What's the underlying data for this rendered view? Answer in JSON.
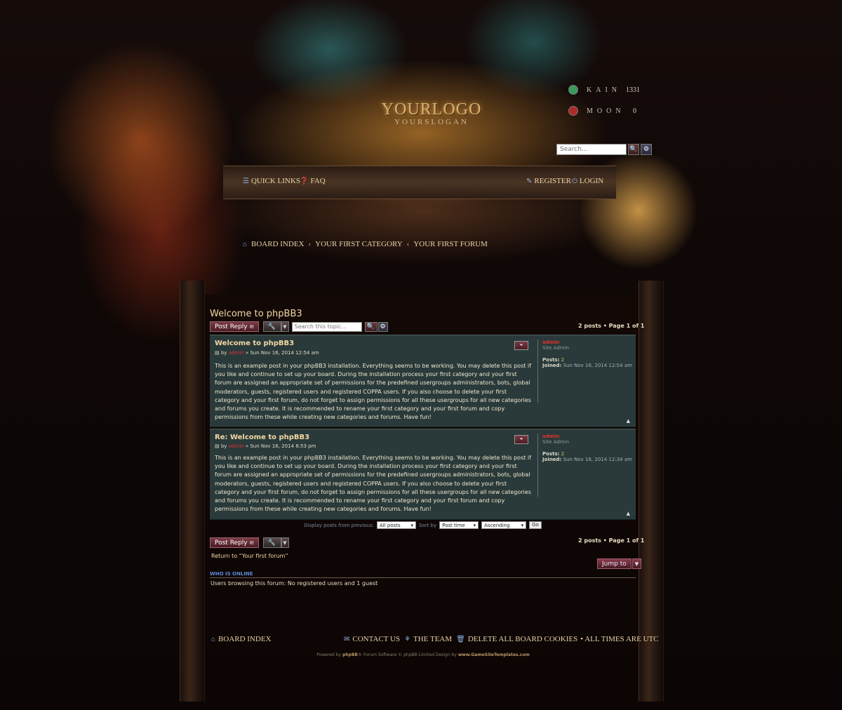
{
  "header": {
    "logo_text": "YOURLOGO",
    "slogan": "YOURSLOGAN",
    "servers": [
      {
        "name": "KAIN",
        "count": "1331",
        "status_color": "#3a9a5a"
      },
      {
        "name": "MOON",
        "count": "0",
        "status_color": "#b02a2a"
      }
    ],
    "search_placeholder": "Search...",
    "search_icon": "magnifier-icon",
    "advanced_icon": "gear-icon"
  },
  "nav": {
    "quick_links": "QUICK LINKS",
    "faq": "FAQ",
    "register": "REGISTER",
    "login": "LOGIN"
  },
  "breadcrumb": [
    "BOARD INDEX",
    "YOUR FIRST CATEGORY",
    "YOUR FIRST FORUM"
  ],
  "topic": {
    "title": "Welcome to phpBB3",
    "post_reply": "Post Reply",
    "search_placeholder": "Search this topic...",
    "pagination": "2 posts • Page 1 of 1"
  },
  "posts": [
    {
      "title": "Welcome to phpBB3",
      "by": "by",
      "author": "admin",
      "date": "» Sun Nov 16, 2014 12:54 am",
      "body": "This is an example post in your phpBB3 installation. Everything seems to be working. You may delete this post if you like and continue to set up your board. During the installation process your first category and your first forum are assigned an appropriate set of permissions for the predefined usergroups administrators, bots, global moderators, guests, registered users and registered COPPA users. If you also choose to delete your first category and your first forum, do not forget to assign permissions for all these usergroups for all new categories and forums you create. It is recommended to rename your first category and your first forum and copy permissions from these while creating new categories and forums. Have fun!",
      "profile_name": "admin",
      "rank": "Site Admin",
      "posts_label": "Posts:",
      "posts_value": "2",
      "joined_label": "Joined:",
      "joined_value": "Sun Nov 16, 2014 12:54 am"
    },
    {
      "title": "Re: Welcome to phpBB3",
      "by": "by",
      "author": "admin",
      "date": "» Sun Nov 16, 2014 8:53 pm",
      "body": "This is an example post in your phpBB3 installation. Everything seems to be working. You may delete this post if you like and continue to set up your board. During the installation process your first category and your first forum are assigned an appropriate set of permissions for the predefined usergroups administrators, bots, global moderators, guests, registered users and registered COPPA users. If you also choose to delete your first category and your first forum, do not forget to assign permissions for all these usergroups for all new categories and forums you create. It is recommended to rename your first category and your first forum and copy permissions from these while creating new categories and forums. Have fun!",
      "profile_name": "admin",
      "rank": "Site Admin",
      "posts_label": "Posts:",
      "posts_value": "2",
      "joined_label": "Joined:",
      "joined_value": "Sun Nov 16, 2014 12:34 am"
    }
  ],
  "sort": {
    "display_label": "Display posts from previous:",
    "display_value": "All posts",
    "sort_label": "Sort by",
    "sort_value": "Post time",
    "order_value": "Ascending",
    "go": "Go"
  },
  "return_link": "Return to “Your first forum”",
  "jump_to": "Jump to",
  "who_is_online": {
    "heading": "WHO IS ONLINE",
    "text": "Users browsing this forum: No registered users and 1 guest"
  },
  "footer": {
    "board_index": "BOARD INDEX",
    "contact_us": "CONTACT US",
    "the_team": "THE TEAM",
    "delete_cookies": "DELETE ALL BOARD COOKIES",
    "times": "• ALL TIMES ARE UTC",
    "credits_powered": "Powered by",
    "credits_phpbb": "phpBB",
    "credits_rest": "® Forum Software © phpBB Limited Design by",
    "credits_site": "www.GameSiteTemplates.com"
  }
}
